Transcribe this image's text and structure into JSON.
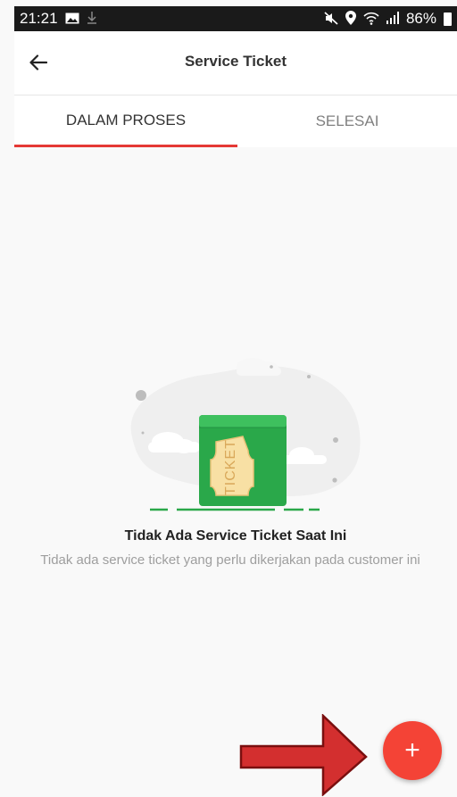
{
  "status_bar": {
    "time": "21:21",
    "battery": "86%",
    "icons": [
      "image-icon",
      "download-icon",
      "mute-icon",
      "location-icon",
      "wifi-icon",
      "signal-icon",
      "battery-icon"
    ]
  },
  "app_bar": {
    "title": "Service Ticket",
    "back_icon": "back-arrow-icon"
  },
  "tabs": [
    {
      "label": "DALAM PROSES",
      "active": true
    },
    {
      "label": "SELESAI",
      "active": false
    }
  ],
  "empty_state": {
    "illustration_text": "TICKET",
    "title": "Tidak Ada Service Ticket Saat Ini",
    "description": "Tidak ada service ticket yang perlu dikerjakan pada customer ini"
  },
  "fab": {
    "label": "+",
    "icon": "plus-icon"
  },
  "colors": {
    "accent": "#e53935",
    "fab": "#f44336",
    "ticket_green": "#2aa84a",
    "annotation_arrow": "#d32f2f"
  }
}
